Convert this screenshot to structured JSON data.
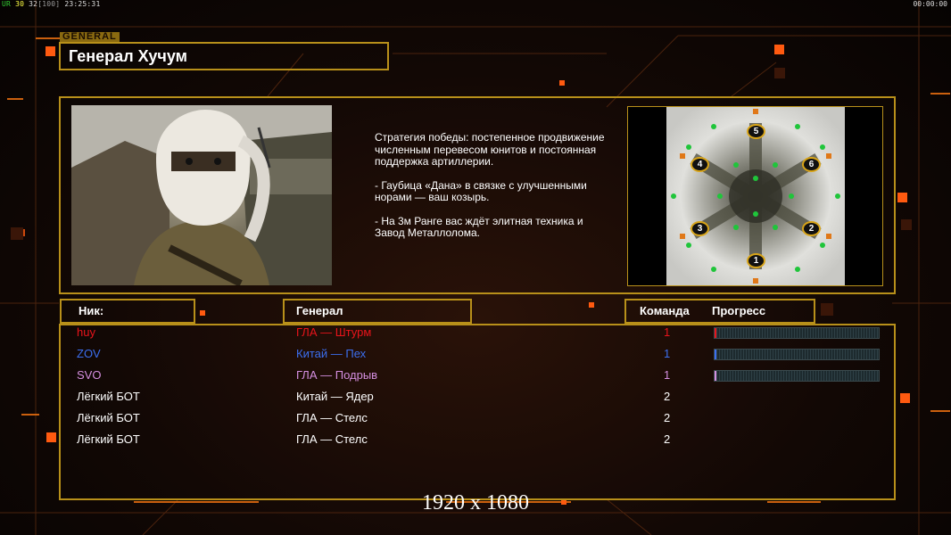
{
  "hud": {
    "top_left": {
      "part1": "UR",
      "part2": "30",
      "part3": "32",
      "part4": "[100]",
      "part5": "23:25:31"
    },
    "top_right": "00:00:00"
  },
  "general": {
    "tag": "GENERAL",
    "name": "Генерал Хучум",
    "strategy": [
      "Стратегия победы: постепенное продвижение численным перевесом юнитов и постоянная поддержка артиллерии.",
      "- Гаубица «Дана» в связке с улучшенными норами — ваш козырь.",
      "- На 3м Ранге вас ждёт элитная техника и Завод Металлолома."
    ]
  },
  "map": {
    "start_positions": [
      "1",
      "2",
      "3",
      "4",
      "5",
      "6"
    ]
  },
  "columns": {
    "nick": "Ник:",
    "general": "Генерал",
    "team": "Команда",
    "progress": "Прогресс"
  },
  "players": [
    {
      "nick": "huy",
      "general": "ГЛА — Штурм",
      "team": "1",
      "color": "#e8141b",
      "progress": 0.01
    },
    {
      "nick": "ZOV",
      "general": "Китай — Пех",
      "team": "1",
      "color": "#3c6ff0",
      "progress": 0.01
    },
    {
      "nick": "SVO",
      "general": "ГЛА — Подрыв",
      "team": "1",
      "color": "#d58fe0",
      "progress": 0.01
    },
    {
      "nick": "Лёгкий БОТ",
      "general": "Китай — Ядер",
      "team": "2",
      "color": "#ffffff",
      "progress": null
    },
    {
      "nick": "Лёгкий БОТ",
      "general": "ГЛА — Стелс",
      "team": "2",
      "color": "#ffffff",
      "progress": null
    },
    {
      "nick": "Лёгкий БОТ",
      "general": "ГЛА — Стелс",
      "team": "2",
      "color": "#ffffff",
      "progress": null
    }
  ],
  "resolution": "1920 x 1080",
  "colors": {
    "gold": "#b8901a",
    "accent_orange": "#ff6a10"
  }
}
